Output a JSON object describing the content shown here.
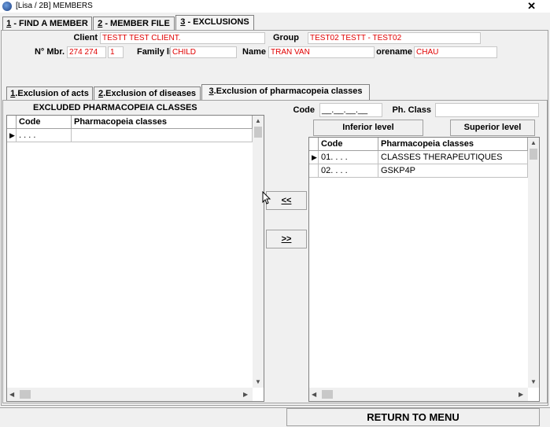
{
  "window": {
    "title": "[Lisa / 2B] MEMBERS",
    "close_glyph": "✕"
  },
  "main_tabs": [
    {
      "num": "1",
      "label": " - FIND A MEMBER"
    },
    {
      "num": "2",
      "label": " - MEMBER FILE"
    },
    {
      "num": "3",
      "label": " - EXCLUSIONS"
    }
  ],
  "member": {
    "client_label": "Client",
    "client_value": "TESTT TEST CLIENT.",
    "group_label": "Group",
    "group_value": "TEST02 TESTT - TEST02",
    "nmbr_label": "N° Mbr.",
    "nmbr_value": "274 274",
    "nmbr_suffix": "1",
    "family_label": "Family li",
    "family_value": "CHILD",
    "name_label": "Name",
    "name_value": "TRAN VAN",
    "prename_label": "orename",
    "prename_value": "CHAU"
  },
  "sub_tabs": [
    {
      "num": "1",
      "label": ".Exclusion of acts"
    },
    {
      "num": "2",
      "label": ".Exclusion of diseases"
    },
    {
      "num": "3",
      "label": ".Exclusion of pharmacopeia classes"
    }
  ],
  "excluded": {
    "title": "EXCLUDED PHARMACOPEIA CLASSES",
    "columns": [
      "Code",
      "Pharmacopeia classes"
    ],
    "rows": [
      {
        "code": ". . . .",
        "name": ""
      }
    ]
  },
  "search": {
    "code_label": "Code",
    "code_value": "__.__.__.__",
    "phclass_label": "Ph. Class",
    "phclass_value": ""
  },
  "buttons": {
    "inferior_level": "Inferior level",
    "superior_level": "Superior level",
    "move_left": "<<",
    "move_right": ">>",
    "return_to_menu": "RETURN TO MENU"
  },
  "available": {
    "columns": [
      "Code",
      "Pharmacopeia classes"
    ],
    "rows": [
      {
        "code": "01. . . .",
        "name": "CLASSES THERAPEUTIQUES"
      },
      {
        "code": "02. . . .",
        "name": "GSKP4P"
      }
    ]
  },
  "colors": {
    "field_text": "#e00000"
  }
}
